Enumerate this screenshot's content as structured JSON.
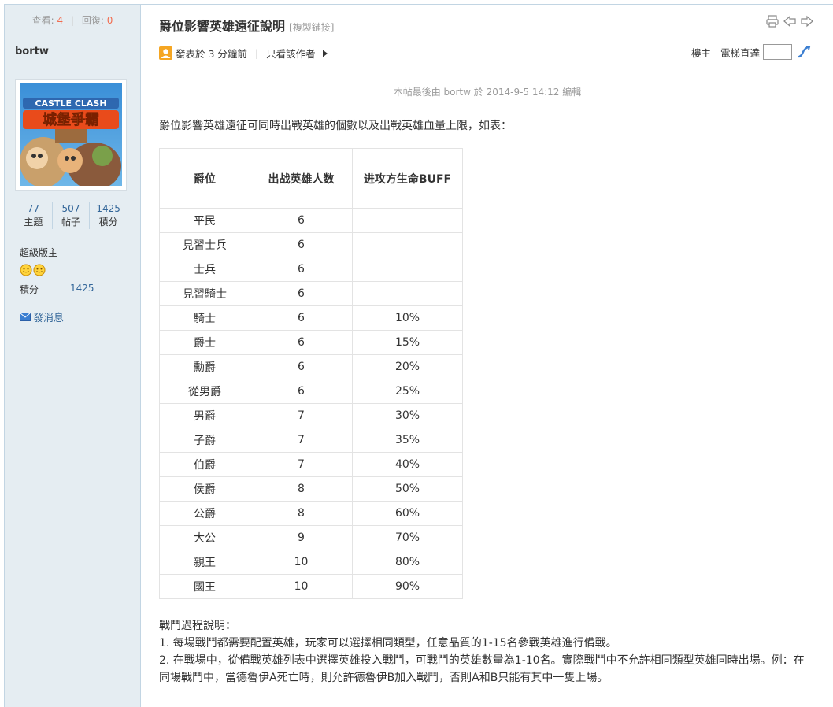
{
  "sidebar": {
    "views_label": "查看:",
    "views_count": "4",
    "replies_label": "回復:",
    "replies_count": "0",
    "author": "bortw",
    "avatar_text_line1": "CASTLE CLASH",
    "avatar_text_line2": "城堡爭霸",
    "stats": [
      {
        "num": "77",
        "label": "主題"
      },
      {
        "num": "507",
        "label": "帖子"
      },
      {
        "num": "1425",
        "label": "積分"
      }
    ],
    "rank_title": "超級版主",
    "points_label": "積分",
    "points_value": "1425",
    "send_message": "發消息"
  },
  "post": {
    "title": "爵位影響英雄遠征說明",
    "copy_link": "[複製鏈接]",
    "posted": "發表於 3 分鐘前",
    "only_author": "只看該作者",
    "floor": "樓主",
    "elevator": "電梯直達",
    "edited_note": "本帖最後由 bortw 於 2014-9-5 14:12 編輯",
    "intro": "爵位影響英雄遠征可同時出戰英雄的個數以及出戰英雄血量上限，如表："
  },
  "table": {
    "headers": [
      "爵位",
      "出战英雄人数",
      "进攻方生命BUFF"
    ],
    "rows": [
      [
        "平民",
        "6",
        ""
      ],
      [
        "見習士兵",
        "6",
        ""
      ],
      [
        "士兵",
        "6",
        ""
      ],
      [
        "見習騎士",
        "6",
        ""
      ],
      [
        "騎士",
        "6",
        "10%"
      ],
      [
        "爵士",
        "6",
        "15%"
      ],
      [
        "勳爵",
        "6",
        "20%"
      ],
      [
        "從男爵",
        "6",
        "25%"
      ],
      [
        "男爵",
        "7",
        "30%"
      ],
      [
        "子爵",
        "7",
        "35%"
      ],
      [
        "伯爵",
        "7",
        "40%"
      ],
      [
        "侯爵",
        "8",
        "50%"
      ],
      [
        "公爵",
        "8",
        "60%"
      ],
      [
        "大公",
        "9",
        "70%"
      ],
      [
        "親王",
        "10",
        "80%"
      ],
      [
        "國王",
        "10",
        "90%"
      ]
    ]
  },
  "description": {
    "heading": "戰鬥過程說明：",
    "line1": "1. 每場戰鬥都需要配置英雄，玩家可以選擇相同類型，任意品質的1-15名參戰英雄進行備戰。",
    "line2": "2. 在戰場中，從備戰英雄列表中選擇英雄投入戰鬥，可戰鬥的英雄數量為1-10名。實際戰鬥中不允許相同類型英雄同時出場。例：在同場戰鬥中，當德魯伊A死亡時，則允許德魯伊B加入戰鬥，否則A和B只能有其中一隻上場。"
  }
}
